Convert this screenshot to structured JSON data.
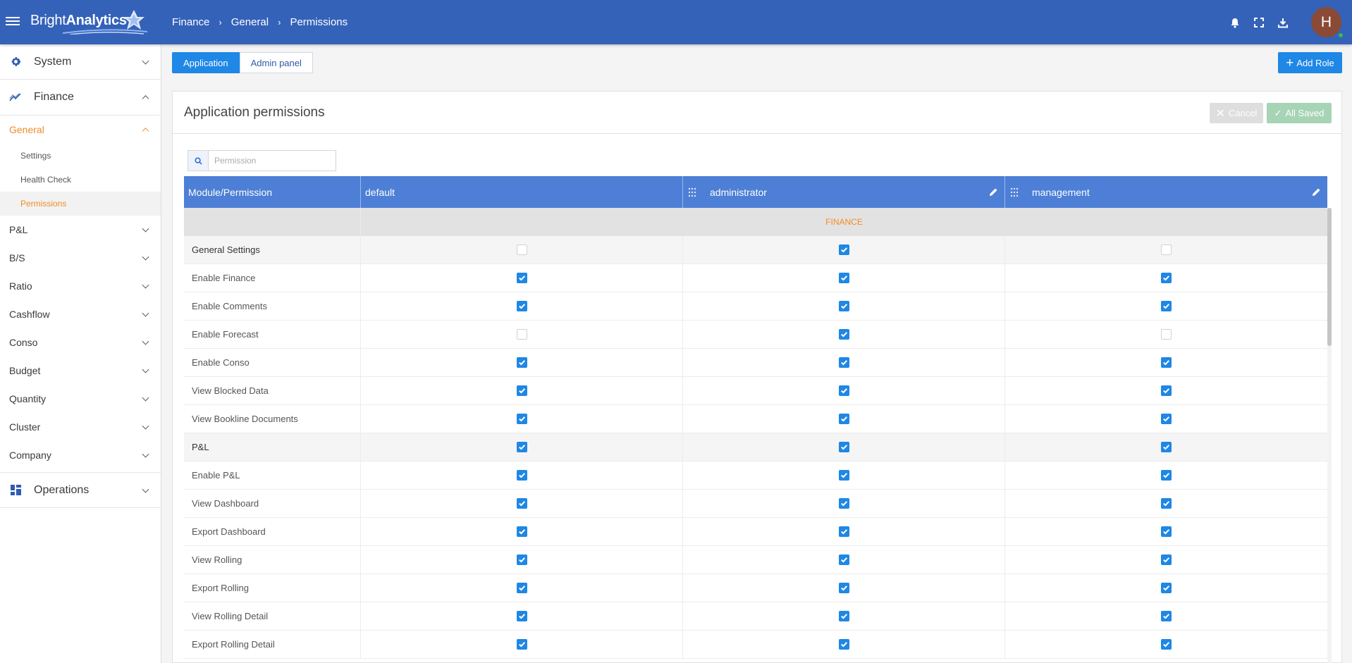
{
  "header": {
    "logo_light": "Bright",
    "logo_bold": "Analytics",
    "breadcrumb": [
      "Finance",
      "General",
      "Permissions"
    ],
    "avatar_initial": "H",
    "colors": {
      "bar": "#3462b9",
      "accent": "#1f87e5",
      "active": "#f28c28"
    }
  },
  "sidebar": {
    "system": "System",
    "finance": "Finance",
    "general": "General",
    "general_items": [
      "Settings",
      "Health Check",
      "Permissions"
    ],
    "modules": [
      "P&L",
      "B/S",
      "Ratio",
      "Cashflow",
      "Conso",
      "Budget",
      "Quantity",
      "Cluster",
      "Company"
    ],
    "operations": "Operations"
  },
  "tabs": [
    "Application",
    "Admin panel"
  ],
  "add_role_label": "Add Role",
  "card": {
    "title": "Application permissions",
    "cancel_label": "Cancel",
    "saved_label": "All Saved"
  },
  "search": {
    "placeholder": "Permission"
  },
  "grid": {
    "columns": [
      "Module/Permission",
      "default",
      "administrator",
      "management"
    ],
    "group": "FINANCE",
    "rows": [
      {
        "label": "General Settings",
        "section": true,
        "values": [
          false,
          true,
          false
        ]
      },
      {
        "label": "Enable Finance",
        "section": false,
        "values": [
          true,
          true,
          true
        ]
      },
      {
        "label": "Enable Comments",
        "section": false,
        "values": [
          true,
          true,
          true
        ]
      },
      {
        "label": "Enable Forecast",
        "section": false,
        "values": [
          false,
          true,
          false
        ]
      },
      {
        "label": "Enable Conso",
        "section": false,
        "values": [
          true,
          true,
          true
        ]
      },
      {
        "label": "View Blocked Data",
        "section": false,
        "values": [
          true,
          true,
          true
        ]
      },
      {
        "label": "View Bookline Documents",
        "section": false,
        "values": [
          true,
          true,
          true
        ]
      },
      {
        "label": "P&L",
        "section": true,
        "values": [
          true,
          true,
          true
        ]
      },
      {
        "label": "Enable P&L",
        "section": false,
        "values": [
          true,
          true,
          true
        ]
      },
      {
        "label": "View Dashboard",
        "section": false,
        "values": [
          true,
          true,
          true
        ]
      },
      {
        "label": "Export Dashboard",
        "section": false,
        "values": [
          true,
          true,
          true
        ]
      },
      {
        "label": "View Rolling",
        "section": false,
        "values": [
          true,
          true,
          true
        ]
      },
      {
        "label": "Export Rolling",
        "section": false,
        "values": [
          true,
          true,
          true
        ]
      },
      {
        "label": "View Rolling Detail",
        "section": false,
        "values": [
          true,
          true,
          true
        ]
      },
      {
        "label": "Export Rolling Detail",
        "section": false,
        "values": [
          true,
          true,
          true
        ]
      }
    ]
  }
}
